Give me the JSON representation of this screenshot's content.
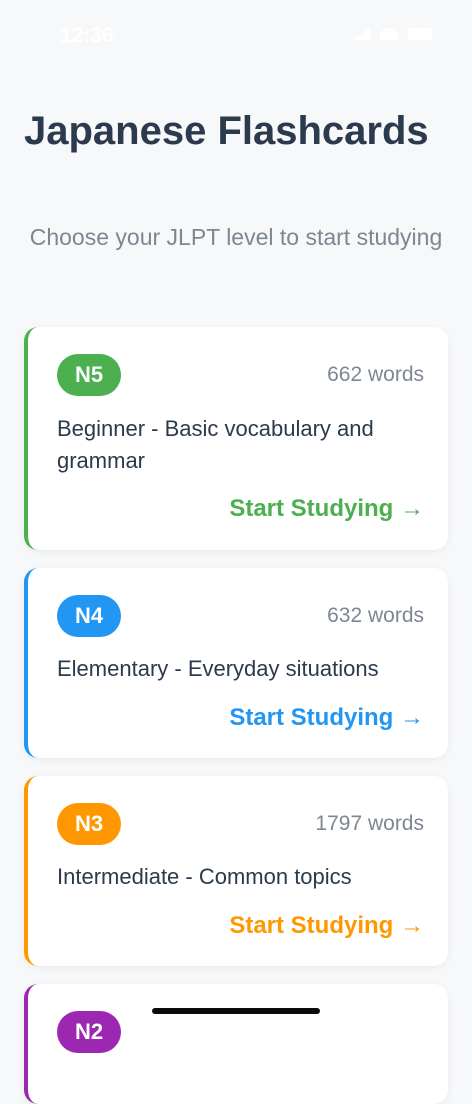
{
  "status_bar": {
    "time": "12:36"
  },
  "header": {
    "title": "Japanese Flashcards",
    "subtitle": "Choose your JLPT level to start studying"
  },
  "levels": [
    {
      "badge": "N5",
      "word_count": "662 words",
      "description": "Beginner - Basic vocabulary and grammar",
      "action": "Start Studying →",
      "color": "#4caf50"
    },
    {
      "badge": "N4",
      "word_count": "632 words",
      "description": "Elementary - Everyday situations",
      "action": "Start Studying →",
      "color": "#2196f3"
    },
    {
      "badge": "N3",
      "word_count": "1797 words",
      "description": "Intermediate - Common topics",
      "action": "Start Studying →",
      "color": "#ff9800"
    },
    {
      "badge": "N2",
      "color": "#9c27b0"
    }
  ]
}
